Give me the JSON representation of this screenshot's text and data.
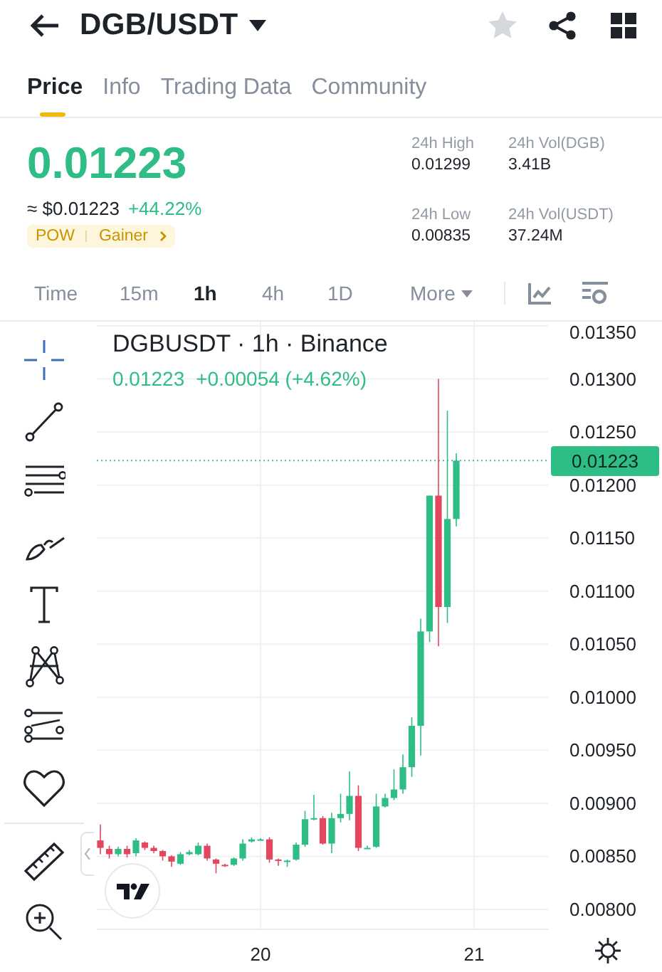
{
  "header": {
    "title": "DGB/USDT"
  },
  "tabs": [
    {
      "label": "Price",
      "selected": true
    },
    {
      "label": "Info",
      "selected": false
    },
    {
      "label": "Trading Data",
      "selected": false
    },
    {
      "label": "Community",
      "selected": false
    }
  ],
  "price": {
    "last": "0.01223",
    "usd": "≈ $0.01223",
    "change": "+44.22%",
    "tags": [
      "POW",
      "Gainer"
    ]
  },
  "stats": [
    {
      "label": "24h High",
      "value": "0.01299"
    },
    {
      "label": "24h Vol(DGB)",
      "value": "3.41B"
    },
    {
      "label": "24h Low",
      "value": "0.00835"
    },
    {
      "label": "24h Vol(USDT)",
      "value": "37.24M"
    }
  ],
  "intervals": [
    {
      "label": "Time",
      "selected": false,
      "kind": "plain"
    },
    {
      "label": "15m",
      "selected": false,
      "kind": "plain"
    },
    {
      "label": "1h",
      "selected": true,
      "kind": "plain"
    },
    {
      "label": "4h",
      "selected": false,
      "kind": "plain"
    },
    {
      "label": "1D",
      "selected": false,
      "kind": "plain"
    },
    {
      "label": "More",
      "selected": false,
      "kind": "menu"
    }
  ],
  "chart": {
    "title": "DGBUSDT · 1h · Binance",
    "legend_price": "0.01223",
    "legend_change": "+0.00054 (+4.62%)",
    "last_price_tag": "0.01223",
    "chart_data": {
      "type": "candlestick",
      "x": [
        19.25,
        19.2917,
        19.3333,
        19.375,
        19.4167,
        19.4583,
        19.5,
        19.5417,
        19.5833,
        19.625,
        19.6667,
        19.7083,
        19.75,
        19.7917,
        19.8333,
        19.875,
        19.9167,
        19.9583,
        20,
        20.0417,
        20.0833,
        20.125,
        20.1667,
        20.2083,
        20.25,
        20.2917,
        20.3333,
        20.375,
        20.4167,
        20.4583,
        20.5,
        20.5417,
        20.5833,
        20.625,
        20.6667,
        20.7083,
        20.75,
        20.7917,
        20.8333,
        20.875,
        20.9167
      ],
      "ohlc": [
        [
          0.00865,
          0.0088,
          0.00852,
          0.00858
        ],
        [
          0.00857,
          0.0086,
          0.00848,
          0.00852
        ],
        [
          0.00852,
          0.00859,
          0.0085,
          0.00857
        ],
        [
          0.00857,
          0.0086,
          0.00849,
          0.00852
        ],
        [
          0.00853,
          0.00867,
          0.0085,
          0.00865
        ],
        [
          0.00863,
          0.00864,
          0.00856,
          0.00858
        ],
        [
          0.00858,
          0.0086,
          0.00853,
          0.00855
        ],
        [
          0.00855,
          0.00856,
          0.00846,
          0.0085
        ],
        [
          0.0085,
          0.00851,
          0.0084,
          0.00845
        ],
        [
          0.00843,
          0.00854,
          0.00842,
          0.00852
        ],
        [
          0.00852,
          0.00856,
          0.00851,
          0.00854
        ],
        [
          0.00852,
          0.00863,
          0.00851,
          0.0086
        ],
        [
          0.0086,
          0.00862,
          0.00846,
          0.00848
        ],
        [
          0.00847,
          0.00848,
          0.00834,
          0.00843
        ],
        [
          0.00842,
          0.00843,
          0.0084,
          0.00841
        ],
        [
          0.00842,
          0.00849,
          0.00841,
          0.00848
        ],
        [
          0.00848,
          0.00866,
          0.00846,
          0.00862
        ],
        [
          0.00864,
          0.00868,
          0.00863,
          0.00866
        ],
        [
          0.00866,
          0.00867,
          0.00865,
          0.00866
        ],
        [
          0.00866,
          0.00868,
          0.00844,
          0.00847
        ],
        [
          0.00847,
          0.00848,
          0.00841,
          0.00846
        ],
        [
          0.00846,
          0.00847,
          0.0084,
          0.00846
        ],
        [
          0.00847,
          0.00863,
          0.00846,
          0.00861
        ],
        [
          0.00861,
          0.00893,
          0.00859,
          0.00885
        ],
        [
          0.00885,
          0.00908,
          0.00884,
          0.00886
        ],
        [
          0.00886,
          0.00888,
          0.00861,
          0.00862
        ],
        [
          0.00862,
          0.00891,
          0.00853,
          0.00886
        ],
        [
          0.00886,
          0.00909,
          0.00882,
          0.0089
        ],
        [
          0.0089,
          0.0093,
          0.00884,
          0.00907
        ],
        [
          0.00907,
          0.00917,
          0.00855,
          0.00858
        ],
        [
          0.00858,
          0.0086,
          0.00857,
          0.00858
        ],
        [
          0.00859,
          0.00909,
          0.00858,
          0.00897
        ],
        [
          0.00897,
          0.00909,
          0.00896,
          0.00905
        ],
        [
          0.00905,
          0.00932,
          0.00903,
          0.00913
        ],
        [
          0.00913,
          0.00946,
          0.00909,
          0.00934
        ],
        [
          0.00934,
          0.00981,
          0.00925,
          0.00973
        ],
        [
          0.00973,
          0.01074,
          0.00945,
          0.01062
        ],
        [
          0.01062,
          0.0119,
          0.01052,
          0.0119
        ],
        [
          0.0119,
          0.013,
          0.01048,
          0.01085
        ],
        [
          0.01085,
          0.0127,
          0.0107,
          0.01168
        ],
        [
          0.01168,
          0.0123,
          0.01161,
          0.01223
        ]
      ],
      "xlim": [
        19.2333,
        21.3467
      ],
      "ylim": [
        0.008,
        0.0135
      ],
      "grid": true,
      "ref_lines": [
        {
          "axis": "y",
          "value": 0.01223,
          "color": "#5bb39a"
        }
      ],
      "yticks": [
        {
          "value": 0.0135,
          "label": "0.01350"
        },
        {
          "value": 0.013,
          "label": "0.01300"
        },
        {
          "value": 0.0125,
          "label": "0.01250"
        },
        {
          "value": 0.012,
          "label": "0.01200"
        },
        {
          "value": 0.0115,
          "label": "0.01150"
        },
        {
          "value": 0.011,
          "label": "0.01100"
        },
        {
          "value": 0.0105,
          "label": "0.01050"
        },
        {
          "value": 0.01,
          "label": "0.01000"
        },
        {
          "value": 0.0095,
          "label": "0.00950"
        },
        {
          "value": 0.009,
          "label": "0.00900"
        },
        {
          "value": 0.0085,
          "label": "0.00850"
        },
        {
          "value": 0.008,
          "label": "0.00800"
        }
      ],
      "xticks": [
        {
          "value": 20,
          "label": "20"
        },
        {
          "value": 21,
          "label": "21"
        }
      ]
    }
  }
}
